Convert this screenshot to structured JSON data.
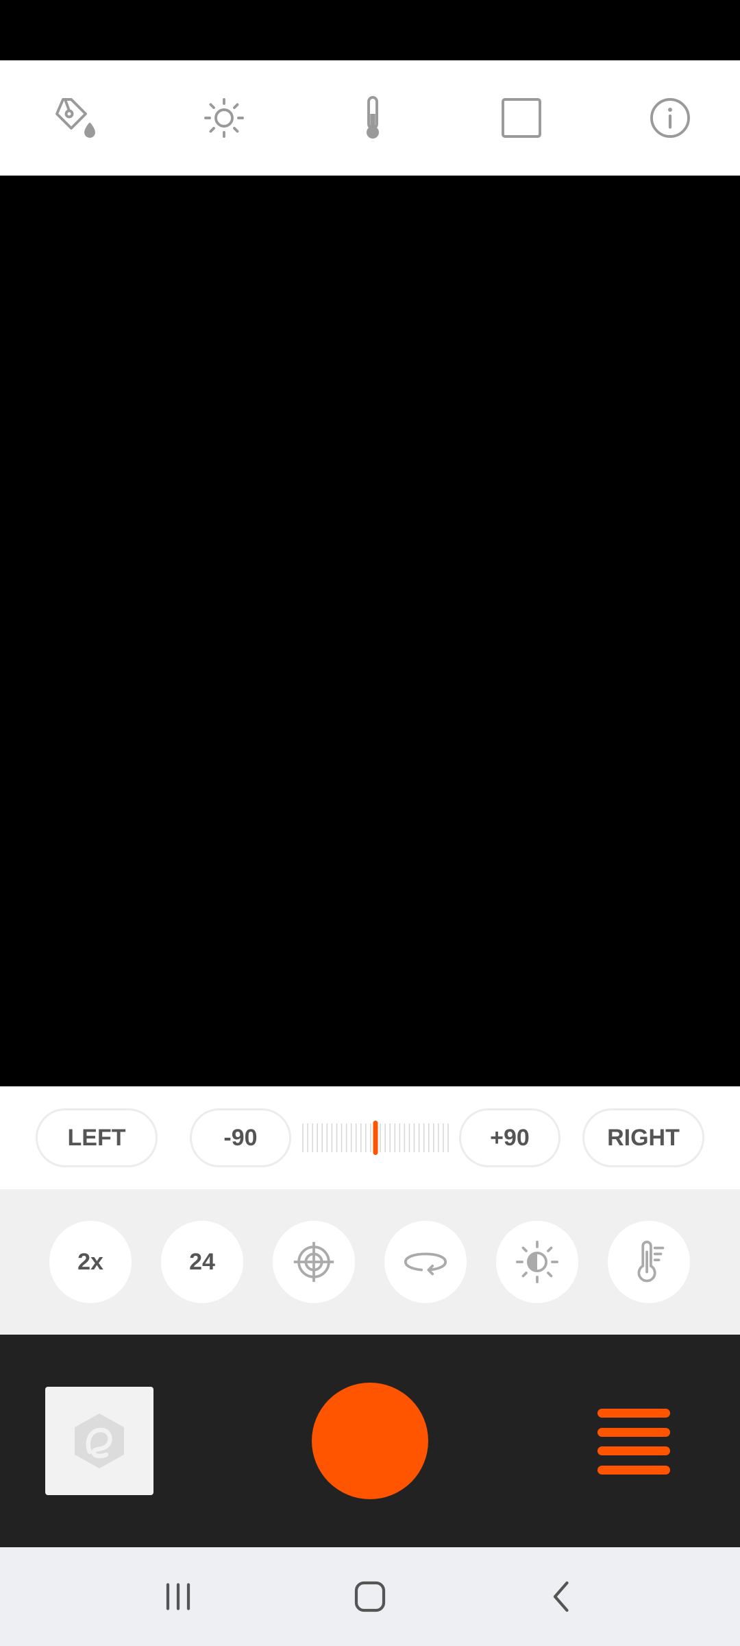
{
  "top_toolbar": {
    "icons": [
      "paint-bucket-icon",
      "brightness-icon",
      "thermometer-icon",
      "square-frame-icon",
      "info-icon"
    ]
  },
  "level_bar": {
    "left_label": "LEFT",
    "min_label": "-90",
    "max_label": "+90",
    "right_label": "RIGHT",
    "value": 0
  },
  "quick_settings": {
    "zoom_label": "2x",
    "fps_label": "24",
    "icons": [
      "target-icon",
      "rotate-icon",
      "exposure-icon",
      "temperature-settings-icon"
    ]
  },
  "colors": {
    "accent": "#ff5500",
    "toolbar_icon": "#9a9a9a",
    "label_text": "#555555"
  }
}
